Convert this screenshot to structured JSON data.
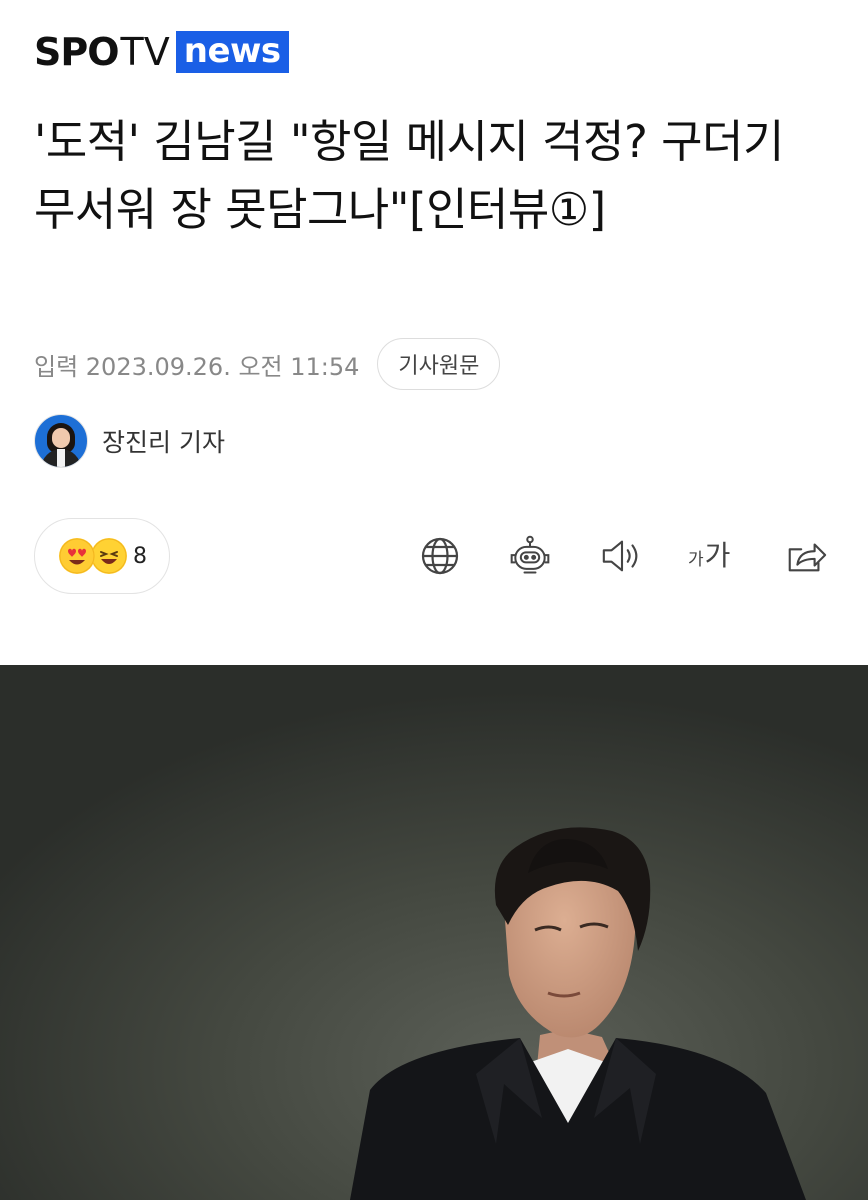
{
  "logo": {
    "spo": "SPO",
    "tv": "TV",
    "news": "news"
  },
  "article": {
    "headline": "'도적' 김남길 \"항일 메시지 걱정? 구더기 무서워 장 못담그나\"[인터뷰①]",
    "published": "입력 2023.09.26. 오전 11:54",
    "original_link_label": "기사원문"
  },
  "reporter": {
    "name": "장진리 기자"
  },
  "reactions": {
    "count": "8",
    "emojis": [
      "heart-eyes-emoji",
      "laughing-emoji"
    ]
  },
  "toolbar": {
    "icons": [
      "globe-icon",
      "robot-icon",
      "speaker-icon",
      "font-size-icon",
      "share-icon"
    ],
    "font_size_small": "가",
    "font_size_large": "가"
  },
  "colors": {
    "brand_blue": "#1a5fe6",
    "emoji_yellow": "#ffcc33",
    "photo_bg": "#41453f"
  }
}
